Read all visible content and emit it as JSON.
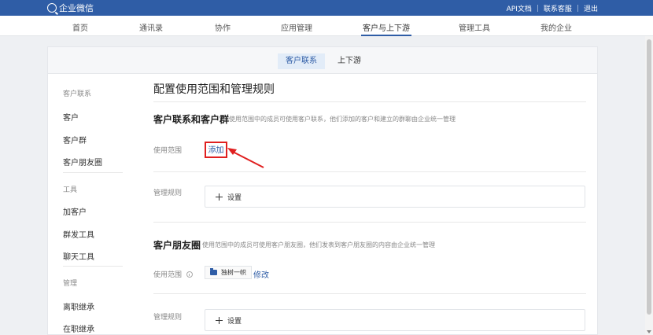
{
  "header": {
    "app_name": "企业微信",
    "links": [
      "API文档",
      "联系客服",
      "退出"
    ],
    "brand_color": "#2f5da6"
  },
  "nav": {
    "items": [
      "首页",
      "通讯录",
      "协作",
      "应用管理",
      "客户与上下游",
      "管理工具",
      "我的企业"
    ],
    "active": "客户与上下游"
  },
  "subnav": {
    "tabs": [
      "客户联系",
      "上下游"
    ],
    "active": "客户联系"
  },
  "sidebar": {
    "groups": [
      {
        "title": "客户联系",
        "items": [
          "客户",
          "客户群",
          "客户朋友圈"
        ]
      },
      {
        "title": "工具",
        "items": [
          "加客户",
          "群发工具",
          "聊天工具"
        ]
      },
      {
        "title": "管理",
        "items": [
          "离职继承",
          "在职继承"
        ]
      }
    ]
  },
  "main": {
    "title": "配置使用范围和管理规则",
    "section1": {
      "title": "客户联系和客户群",
      "desc": "使用范围中的成员可使用客户联系，他们添加的客户和建立的群聊由企业统一管理",
      "scope_label": "使用范围",
      "add_label": "添加",
      "rule_label": "管理规则",
      "setting_label": "设置"
    },
    "section2": {
      "title": "客户朋友圈",
      "desc": "使用范围中的成员可使用客户朋友圈，他们发表到客户朋友圈的内容由企业统一管理",
      "scope_label": "使用范围",
      "dept": "独树一帜",
      "edit_label": "修改",
      "rule_label": "管理规则",
      "setting_label": "设置"
    }
  },
  "icons": [
    "logo-icon",
    "info-icon",
    "folder-icon",
    "plus-icon",
    "arrow-annotation-icon"
  ],
  "highlight_color": "#e02020"
}
